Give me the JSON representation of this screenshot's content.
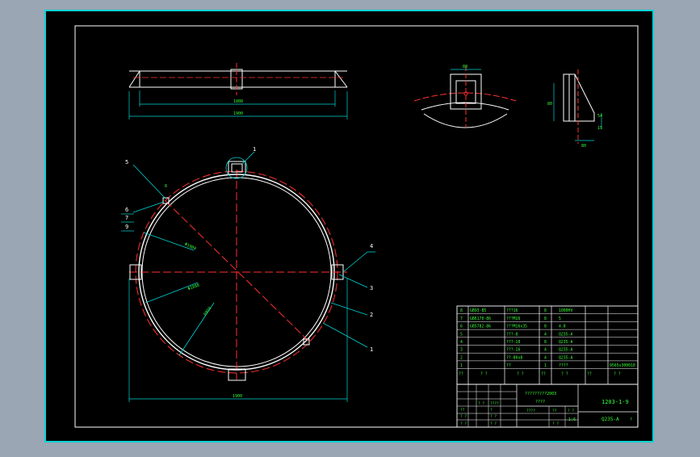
{
  "drawing": {
    "top_view": {
      "dim_inner": "1888",
      "dim_outer": "1900"
    },
    "detail_a": {
      "dim_top": "88"
    },
    "detail_b": {
      "dim_left": "80",
      "dim_right_1": "54",
      "dim_right_2": "15",
      "dim_bottom": "80"
    },
    "main_view": {
      "callouts": [
        "1",
        "2",
        "3",
        "4",
        "5",
        "6",
        "7",
        "8",
        "9"
      ],
      "dim_diameter_1": "Φ1900",
      "dim_diameter_2": "Φ1888",
      "dim_radius": "R950",
      "dim_bottom": "1900",
      "dim_diag": "6"
    }
  },
  "bom": {
    "rows": [
      {
        "no": "8",
        "code": "GB93-85",
        "name": "???16",
        "qty": "8",
        "material": "1000HV",
        "note": ""
      },
      {
        "no": "7",
        "code": "GB6170-86",
        "name": "???M16",
        "qty": "8",
        "material": "5",
        "note": ""
      },
      {
        "no": "6",
        "code": "GB5782-86",
        "name": "???M16x35",
        "qty": "8",
        "material": "4.8",
        "note": ""
      },
      {
        "no": "5",
        "code": "",
        "name": "???-8",
        "qty": "4",
        "material": "Q235-A",
        "note": ""
      },
      {
        "no": "4",
        "code": "",
        "name": "???-10",
        "qty": "8",
        "material": "Q235-A",
        "note": ""
      },
      {
        "no": "3",
        "code": "",
        "name": "???-16",
        "qty": "4",
        "material": "Q235-A",
        "note": ""
      },
      {
        "no": "2",
        "code": "",
        "name": "??-80x8",
        "qty": "4",
        "material": "Q235-A",
        "note": ""
      },
      {
        "no": "1",
        "code": "",
        "name": "??",
        "qty": "1",
        "material": "????",
        "note": "9565x300010"
      }
    ],
    "header": {
      "no": "??",
      "code": "? ?",
      "name": "? ?",
      "qty": "??",
      "material": "? ?",
      "weight": "??",
      "note": "? ?"
    }
  },
  "title_block": {
    "company": "?????????2003",
    "project": "????",
    "drawing_no": "1203-1-9",
    "scale": "1:6",
    "material": "Q235-A",
    "sheet": "?",
    "cells": [
      "????",
      "??",
      "? ?",
      "? ?",
      "????",
      "??",
      "?",
      "? ?",
      "? ?",
      "? ?",
      "? ?",
      "? ?"
    ]
  }
}
